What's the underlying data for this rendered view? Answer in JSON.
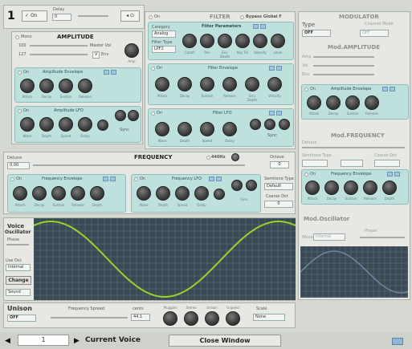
{
  "top": {
    "voice_num": "1",
    "on_label": "On",
    "delay_label": "Delay",
    "delay_value": "0",
    "power_icon": "power-icon"
  },
  "amplitude": {
    "title": "AMPLITUDE",
    "mono_label": "Mono",
    "vol_label": "Master Vol",
    "val1": "100",
    "val2": "127",
    "env_label": "Env",
    "env_btn": "V",
    "knob_label": "Amp"
  },
  "amp_env": {
    "on": "On",
    "title": "Amplitude Envelope",
    "knobs": [
      "Attack",
      "Decay",
      "Sustain",
      "Release"
    ]
  },
  "amp_lfo": {
    "on": "On",
    "title": "Amplitude LFO",
    "knobs": [
      "Wave",
      "Depth",
      "Speed",
      "Delay"
    ],
    "extra": "Sync"
  },
  "filter": {
    "on": "On",
    "title": "FILTER",
    "bypass": "Bypass Global F",
    "cat_label": "Category",
    "cat_value": "Analog",
    "type_label": "Filter Type",
    "type_value": "LPF2",
    "param_title": "Filter Parameters",
    "knobs": [
      "Cutoff",
      "Res",
      "Env Depth",
      "Key Trk",
      "Velocity",
      "Level"
    ]
  },
  "filter_env": {
    "on": "On",
    "title": "Filter Envelope",
    "knobs": [
      "Attack",
      "Decay",
      "Sustain",
      "Release",
      "Env Depth",
      "Velocity"
    ]
  },
  "filter_lfo": {
    "on": "On",
    "title": "Filter LFO",
    "knobs": [
      "Wave",
      "Depth",
      "Speed",
      "Delay"
    ],
    "extra": "Sync"
  },
  "frequency": {
    "title": "FREQUENCY",
    "detune_label": "Detune",
    "detune_value": "0.00",
    "hz_label": "440Hz",
    "octave_label": "Octave",
    "octave_value": "0",
    "semi_label": "Semitone Type",
    "semi_value": "Default",
    "coarse_label": "Coarse Oct",
    "coarse_value": "0"
  },
  "freq_env": {
    "on": "On",
    "title": "Frequency Envelope",
    "knobs": [
      "Attack",
      "Decay",
      "Sustain",
      "Release",
      "Depth"
    ]
  },
  "freq_lfo": {
    "on": "On",
    "title": "Frequency LFO",
    "knobs": [
      "Wave",
      "Depth",
      "Speed",
      "Delay",
      "Sync"
    ]
  },
  "modulator": {
    "title": "MODULATOR",
    "type_label": "Type",
    "type_value": "OFF",
    "ch_label": "Channel Mode",
    "ch_value": "OFF"
  },
  "mod_amp": {
    "title": "Mod.AMPLITUDE",
    "rows": [
      "Amp",
      "Vel",
      "Env"
    ],
    "env_on": "On",
    "env_title": "Amplitude Envelope",
    "knobs": [
      "Attack",
      "Decay",
      "Sustain",
      "Release"
    ]
  },
  "mod_freq": {
    "title": "Mod.FREQUENCY",
    "detune_label": "Detune",
    "semi_label": "Semitone Type",
    "coarse_label": "Coarse Oct",
    "fine_label": "Fine",
    "env_on": "On",
    "env_title": "Frequency Envelope",
    "knobs": [
      "Attack",
      "Decay",
      "Sustain",
      "Release",
      "Depth"
    ]
  },
  "mod_osc": {
    "title": "Mod.Oscillator",
    "wave_label": "Wave",
    "wave_value": "Internal",
    "phase_label": "Phase"
  },
  "osc": {
    "title1": "Voice",
    "title2": "Oscillator",
    "phase_label": "Phase",
    "use_label": "Use Osc",
    "use_value": "Internal",
    "change_btn": "Change",
    "sound_value": "Sound",
    "wave_color": "#9ad22b",
    "grid_bg": "#3a4a55",
    "grid_line": "#596875"
  },
  "unison": {
    "title": "Unison",
    "value": "OFF",
    "spread_label": "Frequency Spread",
    "cents_label": "cents",
    "cents_value": "44.1",
    "knob_labels": [
      "Pluggins",
      "Stereo",
      "Unison",
      "V.speed"
    ],
    "scale_label": "Scale",
    "scale_value": "None"
  },
  "bottom": {
    "voice_num": "1",
    "current": "Current Voice",
    "close": "Close Window"
  }
}
